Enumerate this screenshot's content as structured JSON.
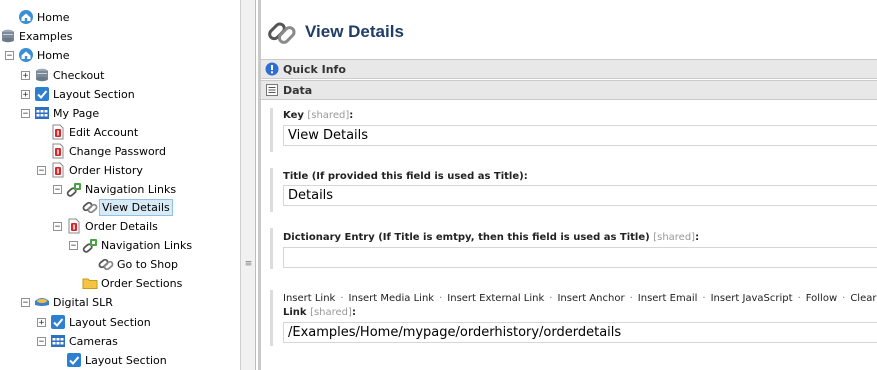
{
  "tree": {
    "items": [
      {
        "label": "Home",
        "icon": "home-icon",
        "toggle": ""
      },
      {
        "label": "Examples",
        "icon": "database-icon",
        "toggle": "-"
      },
      {
        "label": "Home",
        "icon": "home-icon",
        "toggle": "-"
      },
      {
        "label": "Checkout",
        "icon": "database-icon",
        "toggle": "+"
      },
      {
        "label": "Layout Section",
        "icon": "layout-check-icon",
        "toggle": "+"
      },
      {
        "label": "My Page",
        "icon": "grid-icon",
        "toggle": "-"
      },
      {
        "label": "Edit Account",
        "icon": "document-red-icon",
        "toggle": ""
      },
      {
        "label": "Change Password",
        "icon": "document-red-icon",
        "toggle": ""
      },
      {
        "label": "Order History",
        "icon": "document-red-icon",
        "toggle": "-"
      },
      {
        "label": "Navigation Links",
        "icon": "navigation-links-icon",
        "toggle": "-"
      },
      {
        "label": "View Details",
        "icon": "link-icon",
        "toggle": "",
        "selected": true
      },
      {
        "label": "Order Details",
        "icon": "document-red-icon",
        "toggle": "-"
      },
      {
        "label": "Navigation Links",
        "icon": "navigation-links-icon",
        "toggle": "-"
      },
      {
        "label": "Go to Shop",
        "icon": "link-icon",
        "toggle": ""
      },
      {
        "label": "Order Sections",
        "icon": "folder-icon",
        "toggle": ""
      },
      {
        "label": "Digital SLR",
        "icon": "camera-icon",
        "toggle": "-"
      },
      {
        "label": "Layout Section",
        "icon": "layout-check-icon",
        "toggle": "+"
      },
      {
        "label": "Cameras",
        "icon": "grid-icon",
        "toggle": "-"
      },
      {
        "label": "Layout Section",
        "icon": "layout-check-icon",
        "toggle": ""
      }
    ]
  },
  "content": {
    "title": "View Details",
    "sections": {
      "quick_info": "Quick Info",
      "data": "Data"
    },
    "fields": {
      "key": {
        "label": "Key",
        "shared": "[shared]",
        "colon": ":",
        "value": "View Details"
      },
      "title": {
        "label": "Title (If provided this field is used as Title):",
        "value": "Details"
      },
      "dictionary": {
        "label": "Dictionary Entry (If Title is emtpy, then this field is used as Title)",
        "shared": "[shared]",
        "colon": ":",
        "value": ""
      },
      "link": {
        "actions": [
          "Insert Link",
          "Insert Media Link",
          "Insert External Link",
          "Insert Anchor",
          "Insert Email",
          "Insert JavaScript",
          "Follow",
          "Clear"
        ],
        "separator": "·",
        "label": "Link",
        "shared": "[shared]",
        "colon": ":",
        "value": "/Examples/Home/mypage/orderhistory/orderdetails"
      }
    }
  },
  "colors": {
    "title": "#1f3d68",
    "section_bar": "#e8e8e8",
    "selected_bg": "#d9eaf7",
    "shared_text": "#999999"
  }
}
